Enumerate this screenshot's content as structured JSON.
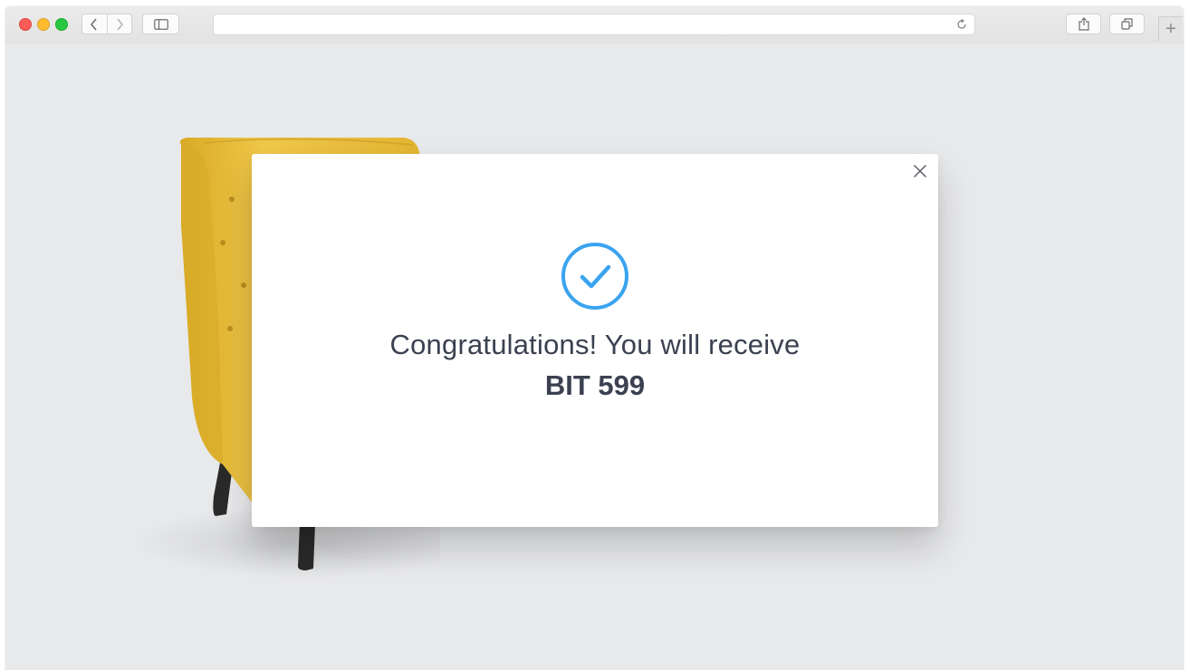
{
  "browser": {
    "address_value": "",
    "icons": {
      "back": "chevron-left-icon",
      "forward": "chevron-right-icon",
      "sidebar": "sidebar-icon",
      "reload": "reload-icon",
      "share": "share-icon",
      "tabs": "tabs-icon",
      "new_tab": "plus-icon"
    },
    "new_tab_label": "+"
  },
  "modal": {
    "line1": "Congratulations! You will receive",
    "line2": "BIT 599",
    "icons": {
      "close": "close-icon",
      "success": "check-circle-icon"
    }
  },
  "colors": {
    "accent": "#3aa3ef",
    "text": "#3b4150",
    "chair": "#e8be3c",
    "background": "#e8e9eb"
  }
}
